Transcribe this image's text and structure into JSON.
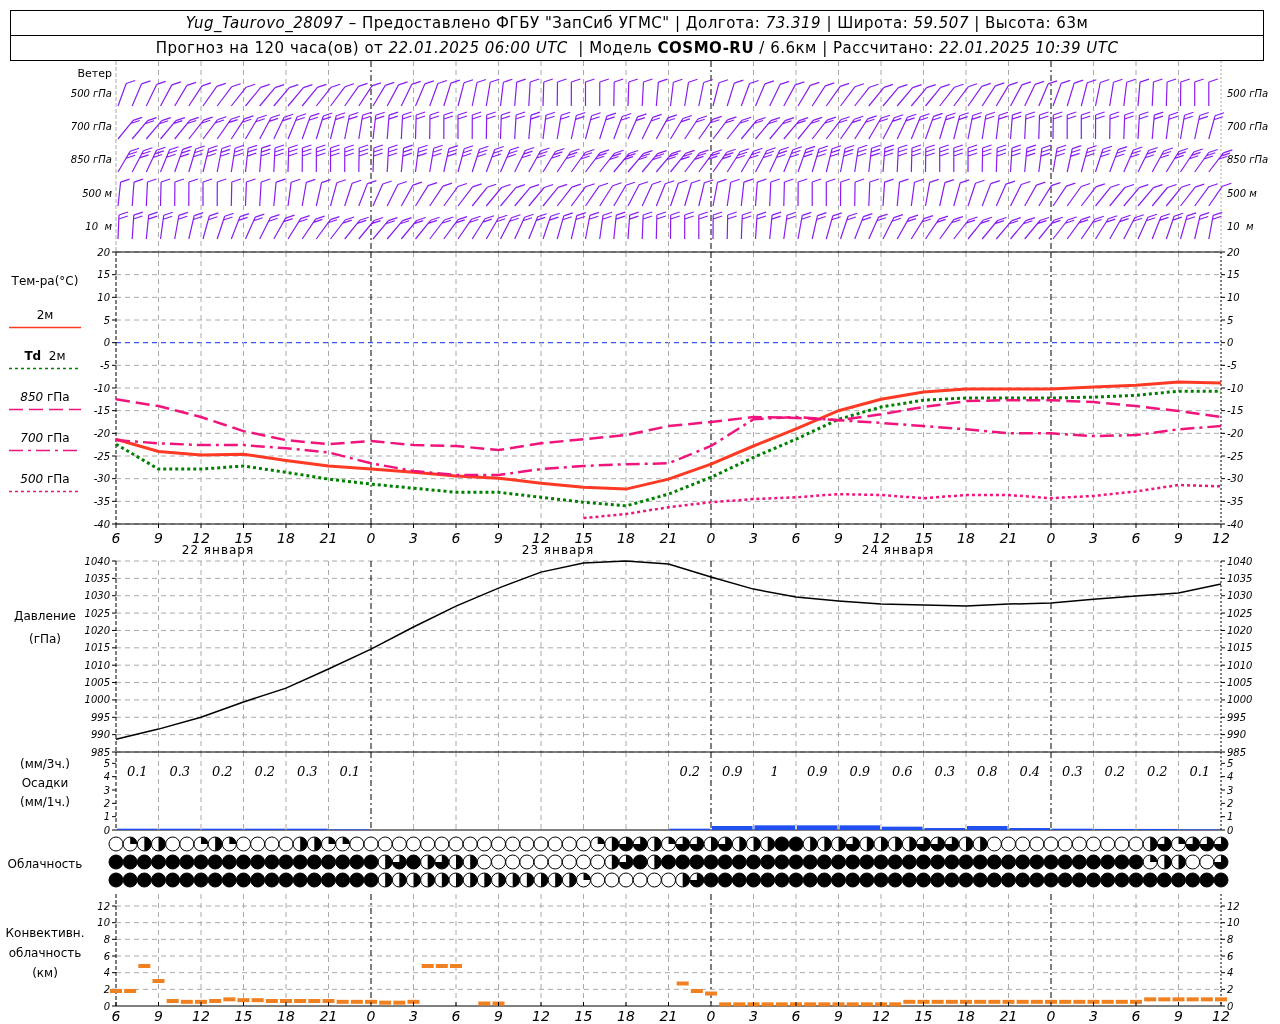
{
  "header": {
    "title": "*Yug_Taurovo_28097* – Предоставлено ФГБУ \"ЗапСиб УГМС\" | Долгота: *73.319* | Широта: *59.507* | Высота: 63м",
    "forecast": "Прогноз на 120 часа(ов) от *22.01.2025 06:00 UTC*  | Модель **COSMO-RU** / 6.6км | Рассчитано: *22.01.2025 10:39 UTC*"
  },
  "wind": {
    "title": "Ветер",
    "levels": [
      "500 гПа",
      "700 гПа",
      "850 гПа",
      "500 м",
      "10  м"
    ],
    "levels_right": [
      "500 гПа",
      "700 гПа",
      "850 гПа",
      "500 м",
      "10  м"
    ]
  },
  "temperature": {
    "title": "Тем-ра(°C)",
    "day_labels": [
      "22 января",
      "23 января",
      "24 января"
    ],
    "right_ticks": [
      "20",
      "15",
      "10",
      "5",
      "0",
      "-5",
      "-10",
      "-15",
      "-20",
      "-25",
      "-30",
      "-35",
      "-40"
    ],
    "chart_data": {
      "type": "line",
      "grid": true,
      "ref_lines": [
        {
          "axis": "y",
          "value": 0,
          "color": "#2040ff"
        }
      ],
      "ylim": [
        -40,
        20
      ],
      "yticks": [
        -40,
        -35,
        -30,
        -25,
        -20,
        -15,
        -10,
        -5,
        0,
        5,
        10,
        15,
        20
      ],
      "categories": [
        "6",
        "9",
        "12",
        "15",
        "18",
        "21",
        "0",
        "3",
        "6",
        "9",
        "12",
        "15",
        "18",
        "21",
        "0",
        "3",
        "6",
        "9",
        "12",
        "15",
        "18",
        "21",
        "0",
        "3",
        "6",
        "9",
        "12"
      ],
      "series": [
        {
          "name": "2м",
          "color": "#ff3a24",
          "line_style": "solid",
          "values": [
            -21.3,
            -24,
            -24.8,
            -24.6,
            -26,
            -27.2,
            -27.9,
            -28.6,
            -29.4,
            -29.9,
            -31,
            -31.9,
            -32.3,
            -30.1,
            -26.8,
            -22.8,
            -19,
            -15,
            -12.5,
            -10.9,
            -10.2,
            -10.2,
            -10.2,
            -9.8,
            -9.4,
            -8.7,
            -8.9
          ]
        },
        {
          "name": "**Td**  2м",
          "color": "#008000",
          "line_style": "dotted",
          "values": [
            -22.4,
            -27.9,
            -27.9,
            -27.2,
            -28.6,
            -30.1,
            -31.2,
            -32.1,
            -33,
            -33,
            -34.1,
            -35.2,
            -36,
            -33.4,
            -29.7,
            -25.3,
            -21.3,
            -16.9,
            -14.2,
            -12.7,
            -12.2,
            -12.2,
            -12.2,
            -12,
            -11.6,
            -10.7,
            -10.7
          ]
        },
        {
          "name": "*850* гПа",
          "color": "#f0147c",
          "line_style": "dashed",
          "values": [
            -12.5,
            -14,
            -16.4,
            -19.5,
            -21.5,
            -22.4,
            -21.7,
            -22.6,
            -22.8,
            -23.7,
            -22.2,
            -21.3,
            -20.4,
            -18.4,
            -17.5,
            -16.4,
            -16.6,
            -17.1,
            -15.8,
            -14.2,
            -12.9,
            -12.7,
            -12.7,
            -13.1,
            -14,
            -15.1,
            -16.4
          ]
        },
        {
          "name": "*700* гПа",
          "color": "#f0147d",
          "line_style": "dashdot",
          "values": [
            -21.5,
            -22.2,
            -22.6,
            -22.6,
            -23.3,
            -24.2,
            -26.6,
            -28.3,
            -29.2,
            -29.2,
            -27.9,
            -27.2,
            -26.8,
            -26.6,
            -22.8,
            -16.9,
            -16.4,
            -17.1,
            -17.7,
            -18.4,
            -19.1,
            -20,
            -20,
            -20.6,
            -20.4,
            -19.1,
            -18.4
          ]
        },
        {
          "name": "*500* гПа",
          "color": "#f0147e",
          "line_style": "dotted",
          "values": [
            null,
            null,
            null,
            null,
            null,
            null,
            null,
            null,
            null,
            null,
            null,
            -38.7,
            -37.8,
            -36.3,
            -35.2,
            -34.5,
            -34.1,
            -33.4,
            -33.6,
            -34.3,
            -33.6,
            -33.6,
            -34.3,
            -33.8,
            -32.8,
            -31.4,
            -31.7
          ]
        }
      ]
    }
  },
  "pressure": {
    "title": "Давление",
    "unit": "(гПа)",
    "right_ticks": [
      "1040",
      "1035",
      "1030",
      "1025",
      "1020",
      "1015",
      "1010",
      "1005",
      "1000",
      "995",
      "990",
      "985"
    ],
    "chart_data": {
      "type": "line",
      "grid": true,
      "ylim": [
        985,
        1040
      ],
      "yticks": [
        985,
        990,
        995,
        1000,
        1005,
        1010,
        1015,
        1020,
        1025,
        1030,
        1035,
        1040
      ],
      "values": [
        988.7,
        991.6,
        995,
        999.4,
        1003.4,
        1008.9,
        1014.6,
        1021,
        1027,
        1032.2,
        1036.8,
        1039.4,
        1040,
        1039.1,
        1035.4,
        1031.9,
        1029.6,
        1028.5,
        1027.6,
        1027.3,
        1027,
        1027.6,
        1027.9,
        1029,
        1029.9,
        1030.8,
        1033.4
      ]
    }
  },
  "precipitation": {
    "labels": [
      "(мм/3ч.)",
      "Осадки",
      "(мм/1ч.)"
    ],
    "right_ticks": [
      "5",
      "4",
      "3",
      "2",
      "1",
      "0"
    ],
    "totals_first": [
      "0.1",
      "0.3",
      "0.2",
      "0.2",
      "0.3",
      "0.1"
    ],
    "totals_last": [
      "0.2",
      "0.9",
      "1",
      "0.9",
      "0.9",
      "0.6",
      "0.3",
      "0.8",
      "0.4",
      "0.3",
      "0.2",
      "0.2",
      "0.1"
    ],
    "chart_data": {
      "type": "bar",
      "ylim": [
        0,
        5.85
      ],
      "yticks": [
        0,
        1,
        2,
        3,
        4,
        5
      ],
      "values": [
        0.1,
        0.1,
        0.1,
        0.1,
        0.1,
        0.05,
        null,
        null,
        null,
        null,
        null,
        null,
        null,
        0.1,
        0.3,
        0.35,
        0.35,
        0.35,
        0.25,
        0.15,
        0.3,
        0.15,
        0.1,
        0.08,
        0.08,
        0.05
      ]
    }
  },
  "cloudiness": {
    "title": "Облачность",
    "rows": [
      [
        {
          "kind": "clear"
        },
        {
          "kind": "few"
        },
        {
          "kind": "half"
        },
        {
          "kind": "half"
        },
        {
          "kind": "clear"
        },
        {
          "kind": "clear"
        },
        {
          "kind": "few"
        },
        {
          "kind": "half"
        },
        {
          "kind": "few"
        },
        {
          "kind": "clear"
        },
        {
          "kind": "clear"
        },
        {
          "kind": "clear"
        },
        {
          "kind": "clear"
        },
        {
          "kind": "half"
        },
        {
          "kind": "half"
        },
        {
          "kind": "few"
        },
        {
          "kind": "few"
        },
        {
          "kind": "clear"
        },
        {
          "kind": "clear"
        },
        {
          "kind": "clear"
        },
        {
          "kind": "clear"
        },
        {
          "kind": "clear"
        },
        {
          "kind": "clear"
        },
        {
          "kind": "clear"
        },
        {
          "kind": "clear"
        },
        {
          "kind": "clear"
        },
        {
          "kind": "clear"
        },
        {
          "kind": "clear"
        },
        {
          "kind": "clear"
        },
        {
          "kind": "clear"
        },
        {
          "kind": "clear"
        },
        {
          "kind": "clear"
        },
        {
          "kind": "clear"
        },
        {
          "kind": "clear"
        },
        {
          "kind": "few"
        },
        {
          "kind": "half"
        },
        {
          "kind": "most"
        },
        {
          "kind": "most"
        },
        {
          "kind": "half"
        },
        {
          "kind": "few"
        },
        {
          "kind": "most"
        },
        {
          "kind": "most"
        },
        {
          "kind": "half"
        },
        {
          "kind": "most"
        },
        {
          "kind": "half"
        },
        {
          "kind": "half"
        },
        {
          "kind": "half"
        },
        {
          "kind": "full"
        },
        {
          "kind": "full"
        },
        {
          "kind": "half"
        },
        {
          "kind": "half"
        },
        {
          "kind": "half"
        },
        {
          "kind": "most"
        },
        {
          "kind": "half"
        },
        {
          "kind": "half"
        },
        {
          "kind": "half"
        },
        {
          "kind": "half"
        },
        {
          "kind": "most"
        },
        {
          "kind": "most"
        },
        {
          "kind": "most"
        },
        {
          "kind": "half"
        },
        {
          "kind": "half"
        },
        {
          "kind": "clear"
        },
        {
          "kind": "clear"
        },
        {
          "kind": "clear"
        },
        {
          "kind": "clear"
        },
        {
          "kind": "clear"
        },
        {
          "kind": "clear"
        },
        {
          "kind": "clear"
        },
        {
          "kind": "clear"
        },
        {
          "kind": "clear"
        },
        {
          "kind": "clear"
        },
        {
          "kind": "clear"
        },
        {
          "kind": "half"
        },
        {
          "kind": "most"
        },
        {
          "kind": "few"
        },
        {
          "kind": "most"
        },
        {
          "kind": "most"
        },
        {
          "kind": "most"
        }
      ],
      [
        {
          "kind": "full"
        },
        {
          "kind": "full"
        },
        {
          "kind": "full"
        },
        {
          "kind": "full"
        },
        {
          "kind": "full"
        },
        {
          "kind": "full"
        },
        {
          "kind": "full"
        },
        {
          "kind": "full"
        },
        {
          "kind": "full"
        },
        {
          "kind": "full"
        },
        {
          "kind": "full"
        },
        {
          "kind": "full"
        },
        {
          "kind": "full"
        },
        {
          "kind": "full"
        },
        {
          "kind": "full"
        },
        {
          "kind": "full"
        },
        {
          "kind": "full"
        },
        {
          "kind": "full"
        },
        {
          "kind": "full"
        },
        {
          "kind": "half"
        },
        {
          "kind": "most"
        },
        {
          "kind": "full"
        },
        {
          "kind": "half"
        },
        {
          "kind": "most"
        },
        {
          "kind": "half"
        },
        {
          "kind": "half"
        },
        {
          "kind": "clear"
        },
        {
          "kind": "clear"
        },
        {
          "kind": "clear"
        },
        {
          "kind": "clear"
        },
        {
          "kind": "clear"
        },
        {
          "kind": "clear"
        },
        {
          "kind": "clear"
        },
        {
          "kind": "clear"
        },
        {
          "kind": "clear"
        },
        {
          "kind": "half"
        },
        {
          "kind": "most"
        },
        {
          "kind": "full"
        },
        {
          "kind": "half"
        },
        {
          "kind": "full"
        },
        {
          "kind": "full"
        },
        {
          "kind": "full"
        },
        {
          "kind": "full"
        },
        {
          "kind": "full"
        },
        {
          "kind": "full"
        },
        {
          "kind": "full"
        },
        {
          "kind": "full"
        },
        {
          "kind": "full"
        },
        {
          "kind": "full"
        },
        {
          "kind": "full"
        },
        {
          "kind": "full"
        },
        {
          "kind": "full"
        },
        {
          "kind": "full"
        },
        {
          "kind": "full"
        },
        {
          "kind": "full"
        },
        {
          "kind": "full"
        },
        {
          "kind": "full"
        },
        {
          "kind": "full"
        },
        {
          "kind": "full"
        },
        {
          "kind": "full"
        },
        {
          "kind": "full"
        },
        {
          "kind": "full"
        },
        {
          "kind": "full"
        },
        {
          "kind": "full"
        },
        {
          "kind": "full"
        },
        {
          "kind": "full"
        },
        {
          "kind": "full"
        },
        {
          "kind": "full"
        },
        {
          "kind": "full"
        },
        {
          "kind": "full"
        },
        {
          "kind": "full"
        },
        {
          "kind": "full"
        },
        {
          "kind": "full"
        },
        {
          "kind": "few"
        },
        {
          "kind": "half"
        },
        {
          "kind": "half"
        },
        {
          "kind": "clear"
        },
        {
          "kind": "clear"
        },
        {
          "kind": "most"
        }
      ],
      [
        {
          "kind": "full"
        },
        {
          "kind": "full"
        },
        {
          "kind": "full"
        },
        {
          "kind": "full"
        },
        {
          "kind": "full"
        },
        {
          "kind": "full"
        },
        {
          "kind": "full"
        },
        {
          "kind": "full"
        },
        {
          "kind": "full"
        },
        {
          "kind": "full"
        },
        {
          "kind": "full"
        },
        {
          "kind": "full"
        },
        {
          "kind": "full"
        },
        {
          "kind": "full"
        },
        {
          "kind": "full"
        },
        {
          "kind": "full"
        },
        {
          "kind": "full"
        },
        {
          "kind": "full"
        },
        {
          "kind": "full"
        },
        {
          "kind": "half"
        },
        {
          "kind": "half"
        },
        {
          "kind": "half"
        },
        {
          "kind": "half"
        },
        {
          "kind": "half"
        },
        {
          "kind": "half"
        },
        {
          "kind": "half"
        },
        {
          "kind": "half"
        },
        {
          "kind": "half"
        },
        {
          "kind": "half"
        },
        {
          "kind": "half"
        },
        {
          "kind": "half"
        },
        {
          "kind": "half"
        },
        {
          "kind": "half"
        },
        {
          "kind": "few"
        },
        {
          "kind": "clear"
        },
        {
          "kind": "clear"
        },
        {
          "kind": "clear"
        },
        {
          "kind": "clear"
        },
        {
          "kind": "clear"
        },
        {
          "kind": "clear"
        },
        {
          "kind": "half"
        },
        {
          "kind": "most"
        },
        {
          "kind": "full"
        },
        {
          "kind": "full"
        },
        {
          "kind": "full"
        },
        {
          "kind": "full"
        },
        {
          "kind": "full"
        },
        {
          "kind": "full"
        },
        {
          "kind": "full"
        },
        {
          "kind": "full"
        },
        {
          "kind": "full"
        },
        {
          "kind": "full"
        },
        {
          "kind": "full"
        },
        {
          "kind": "full"
        },
        {
          "kind": "full"
        },
        {
          "kind": "full"
        },
        {
          "kind": "full"
        },
        {
          "kind": "full"
        },
        {
          "kind": "full"
        },
        {
          "kind": "full"
        },
        {
          "kind": "full"
        },
        {
          "kind": "full"
        },
        {
          "kind": "full"
        },
        {
          "kind": "full"
        },
        {
          "kind": "full"
        },
        {
          "kind": "full"
        },
        {
          "kind": "full"
        },
        {
          "kind": "full"
        },
        {
          "kind": "full"
        },
        {
          "kind": "full"
        },
        {
          "kind": "full"
        },
        {
          "kind": "full"
        },
        {
          "kind": "full"
        },
        {
          "kind": "full"
        },
        {
          "kind": "full"
        },
        {
          "kind": "full"
        },
        {
          "kind": "full"
        },
        {
          "kind": "full"
        },
        {
          "kind": "full"
        }
      ]
    ]
  },
  "convective": {
    "labels": [
      "Конвективн.",
      "облачность",
      "(км)"
    ],
    "right_ticks": [
      "12",
      "10",
      "8",
      "6",
      "4",
      "2",
      "0"
    ],
    "chart_data": {
      "type": "scatter",
      "grid": true,
      "ylim": [
        0,
        13.44
      ],
      "yticks": [
        0,
        2,
        4,
        6,
        8,
        10,
        12
      ],
      "categories": [
        "6",
        null,
        null,
        "9",
        null,
        null,
        "12",
        null,
        null,
        "15",
        null,
        null,
        "18",
        null,
        null,
        "21",
        null,
        null,
        "0",
        null,
        null,
        "3",
        null,
        null,
        "6",
        null,
        null,
        "9",
        null,
        null,
        "12",
        null,
        null,
        "15",
        null,
        null,
        "18",
        null,
        null,
        "21",
        null,
        null,
        "0",
        null,
        null,
        "3",
        null,
        null,
        "6",
        null,
        null,
        "9",
        null,
        null,
        "12",
        null,
        null,
        "15",
        null,
        null,
        "18",
        null,
        null,
        "21",
        null,
        null,
        "0",
        null,
        null,
        "3",
        null,
        null,
        "6",
        null,
        null,
        "9",
        null,
        null,
        "12"
      ],
      "values": [
        1.8,
        1.8,
        4.8,
        3.0,
        0.6,
        0.5,
        0.5,
        0.6,
        0.8,
        0.7,
        0.7,
        0.6,
        0.6,
        0.6,
        0.6,
        0.6,
        0.5,
        0.5,
        0.5,
        0.4,
        0.4,
        0.5,
        4.8,
        4.8,
        4.8,
        null,
        0.3,
        0.3,
        null,
        null,
        null,
        null,
        null,
        null,
        null,
        null,
        null,
        null,
        null,
        null,
        2.7,
        1.8,
        1.5,
        0.2,
        0.2,
        0.2,
        0.2,
        0.2,
        0.2,
        0.2,
        0.2,
        0.2,
        0.2,
        0.2,
        0.2,
        0.2,
        0.5,
        0.5,
        0.5,
        0.5,
        0.5,
        0.5,
        0.5,
        0.5,
        0.5,
        0.5,
        0.5,
        0.5,
        0.5,
        0.5,
        0.5,
        0.5,
        0.5,
        0.8,
        0.8,
        0.8,
        0.8,
        0.8,
        0.8
      ]
    }
  }
}
